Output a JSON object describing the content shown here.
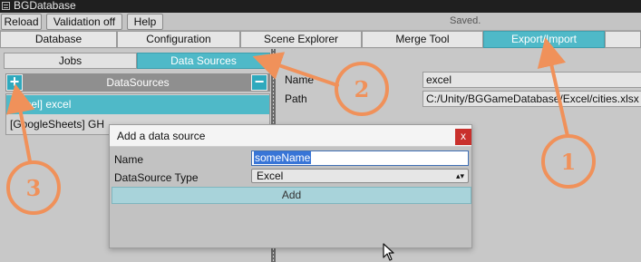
{
  "window": {
    "title": "BGDatabase",
    "status": "Saved."
  },
  "toolbar": {
    "reload": "Reload",
    "validation": "Validation off",
    "help": "Help"
  },
  "main_tabs": [
    "Database",
    "Configuration",
    "Scene Explorer",
    "Merge Tool",
    "Export/Import"
  ],
  "active_main_tab": "Export/Import",
  "sub_tabs": [
    "Jobs",
    "Data Sources"
  ],
  "active_sub_tab": "Data Sources",
  "datasources": {
    "header": "DataSources",
    "add_label": "+",
    "remove_label": "−",
    "items": [
      "[Excel] excel",
      "[GoogleSheets] GH"
    ],
    "selected_index": 0
  },
  "properties": {
    "name_label": "Name",
    "name_value": "excel",
    "path_label": "Path",
    "path_value": "C:/Unity/BGGameDatabase/Excel/cities.xlsx"
  },
  "dialog": {
    "title": "Add a data source",
    "close": "x",
    "name_label": "Name",
    "name_value": "someName",
    "type_label": "DataSource Type",
    "type_value": "Excel",
    "add_button": "Add"
  },
  "annotations": [
    "1",
    "2",
    "3"
  ],
  "colors": {
    "accent": "#4fb9c8",
    "annotation": "#f0915a",
    "close": "#c9302c"
  }
}
